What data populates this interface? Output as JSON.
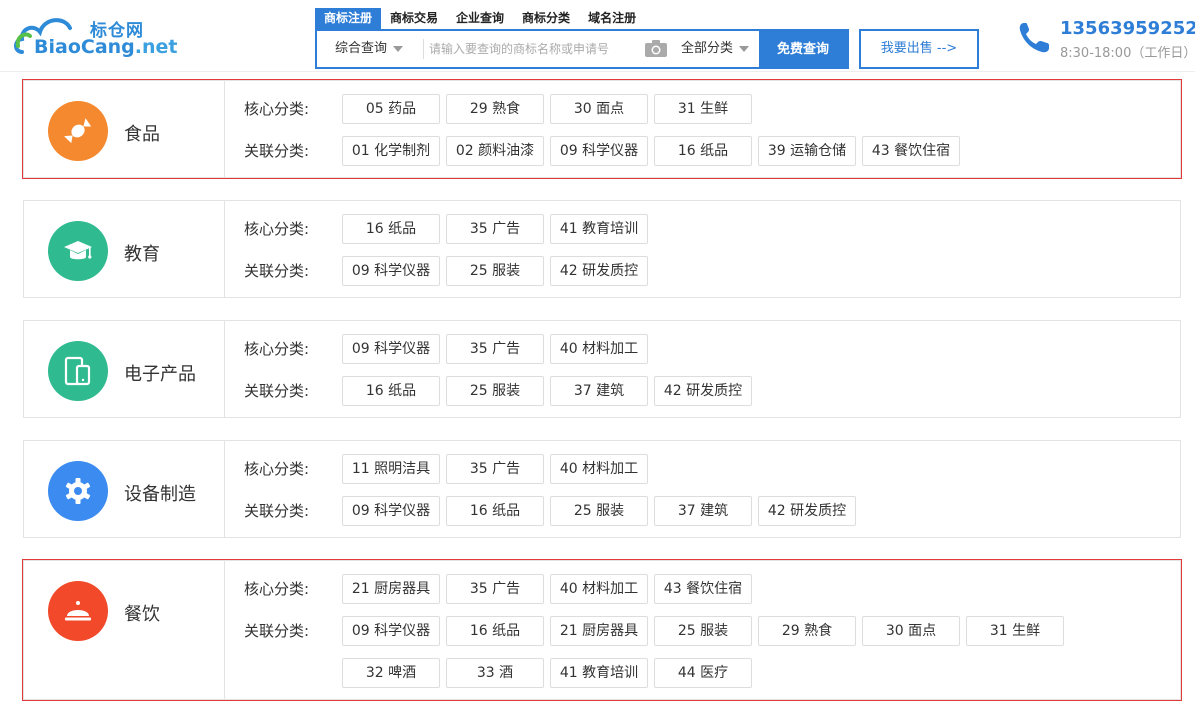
{
  "header": {
    "logo_cn": "标仓网",
    "logo_en_main": "BiaoCang",
    "logo_en_suffix": ".net",
    "tabs": [
      {
        "label": "商标注册",
        "active": true
      },
      {
        "label": "商标交易",
        "active": false
      },
      {
        "label": "企业查询",
        "active": false
      },
      {
        "label": "商标分类",
        "active": false
      },
      {
        "label": "域名注册",
        "active": false
      }
    ],
    "search": {
      "left_select": "综合查询",
      "placeholder": "请输入要查询的商标名称或申请号",
      "right_select": "全部分类",
      "button": "免费查询"
    },
    "sell_button": "我要出售 -->",
    "phone": "13563959252",
    "hours": "8:30-18:00（工作日）"
  },
  "labels": {
    "core": "核心分类:",
    "related": "关联分类:"
  },
  "colors": {
    "brand": "#2e7dd6",
    "highlight_border": "#e03a3a"
  },
  "categories": [
    {
      "name": "食品",
      "icon": "candy-icon",
      "color": "#f5892f",
      "highlighted": true,
      "core": [
        "05 药品",
        "29 熟食",
        "30 面点",
        "31 生鲜"
      ],
      "related": [
        "01 化学制剂",
        "02 颜料油漆",
        "09 科学仪器",
        "16 纸品",
        "39 运输仓储",
        "43 餐饮住宿"
      ]
    },
    {
      "name": "教育",
      "icon": "graduation-cap-icon",
      "color": "#2fba8f",
      "highlighted": false,
      "core": [
        "16 纸品",
        "35 广告",
        "41 教育培训"
      ],
      "related": [
        "09 科学仪器",
        "25 服装",
        "42 研发质控"
      ]
    },
    {
      "name": "电子产品",
      "icon": "devices-icon",
      "color": "#2fba8f",
      "highlighted": false,
      "core": [
        "09 科学仪器",
        "35 广告",
        "40 材料加工"
      ],
      "related": [
        "16 纸品",
        "25 服装",
        "37 建筑",
        "42 研发质控"
      ]
    },
    {
      "name": "设备制造",
      "icon": "gear-icon",
      "color": "#3b8bf0",
      "highlighted": false,
      "core": [
        "11 照明洁具",
        "35 广告",
        "40 材料加工"
      ],
      "related": [
        "09 科学仪器",
        "16 纸品",
        "25 服装",
        "37 建筑",
        "42 研发质控"
      ]
    },
    {
      "name": "餐饮",
      "icon": "cloche-icon",
      "color": "#f2492b",
      "highlighted": true,
      "core": [
        "21 厨房器具",
        "35 广告",
        "40 材料加工",
        "43 餐饮住宿"
      ],
      "related": [
        "09 科学仪器",
        "16 纸品",
        "21 厨房器具",
        "25 服装",
        "29 熟食",
        "30 面点",
        "31 生鲜",
        "32 啤酒",
        "33 酒",
        "41 教育培训",
        "44 医疗"
      ]
    }
  ]
}
